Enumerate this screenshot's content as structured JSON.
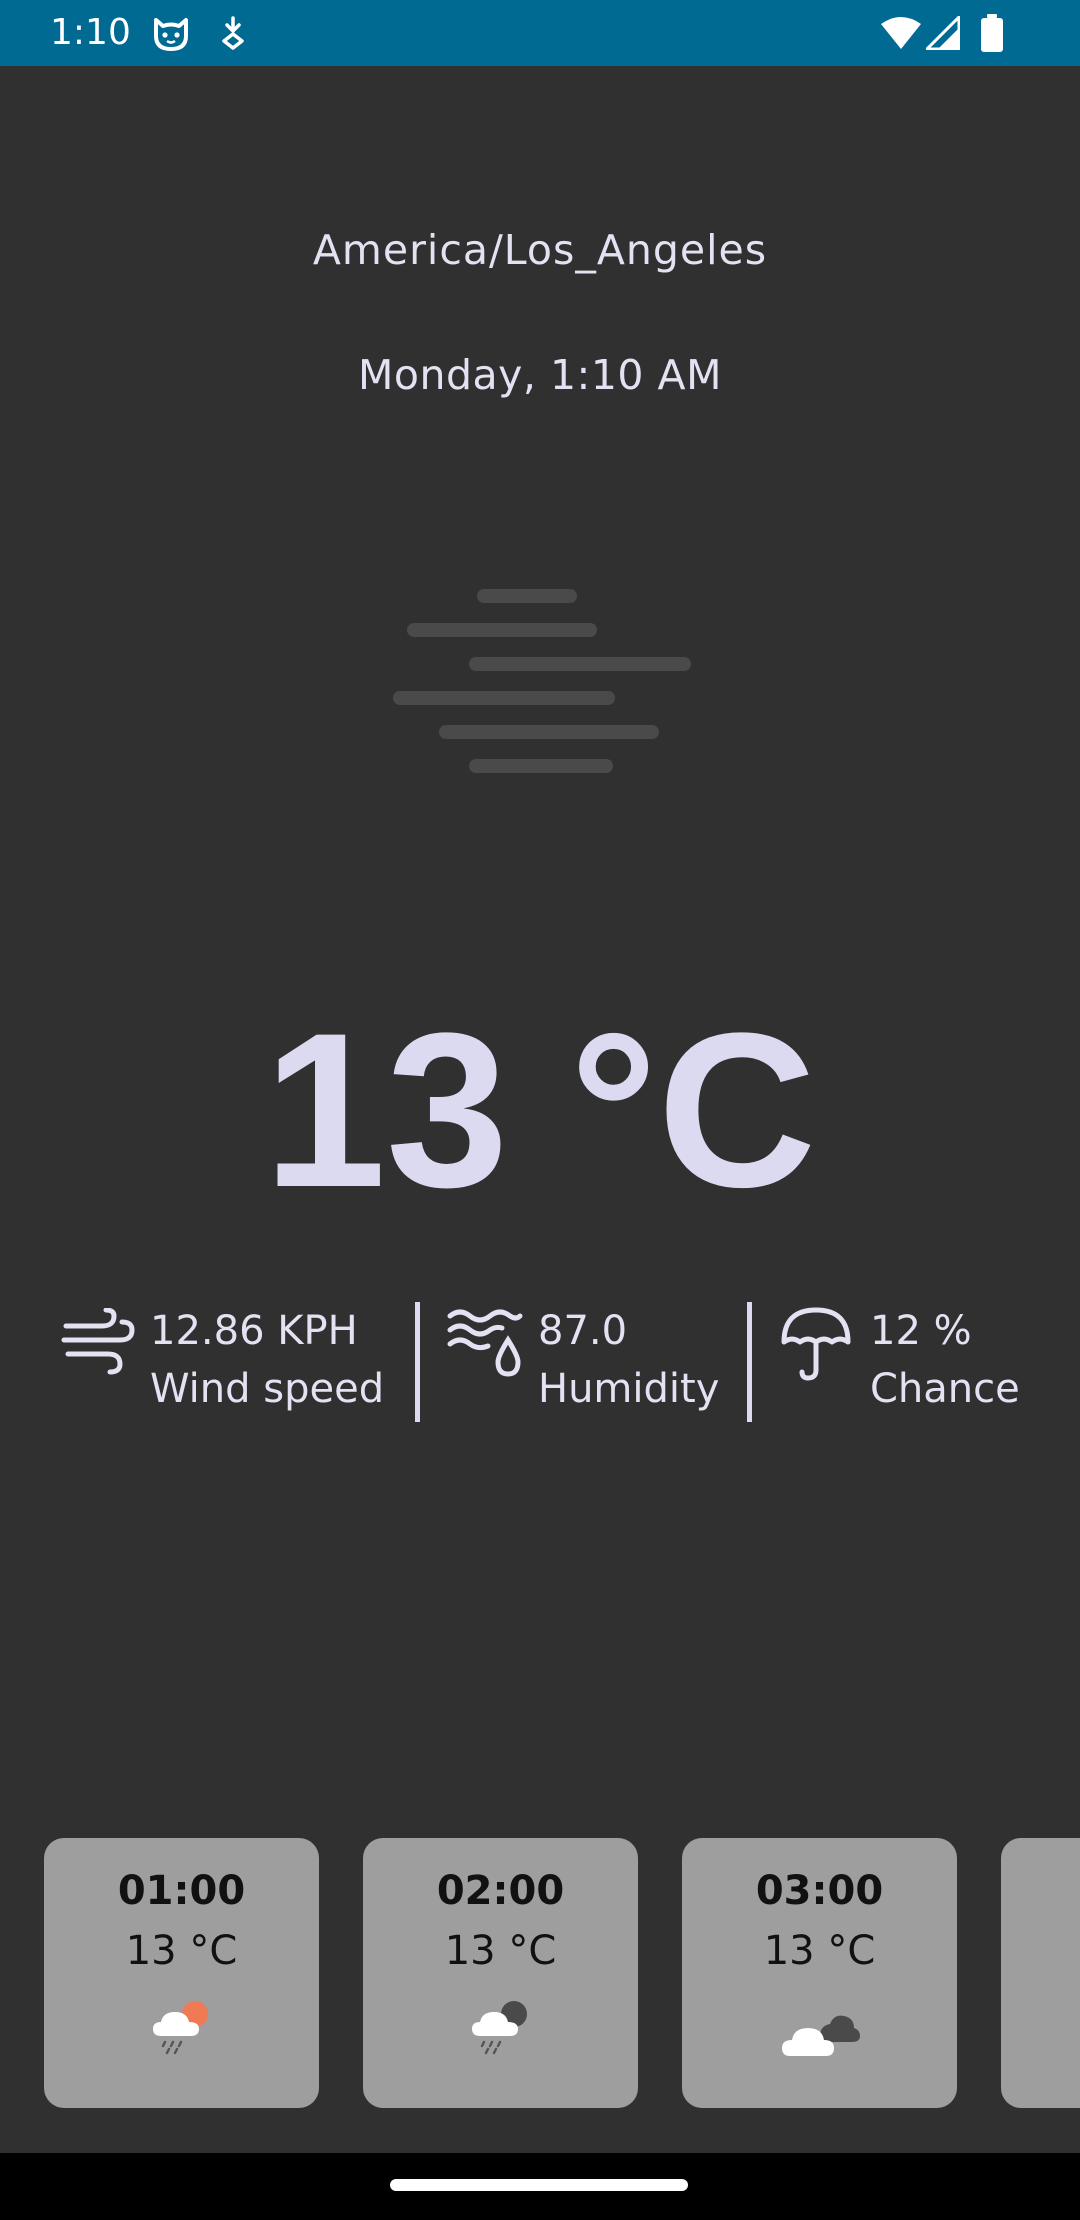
{
  "status_bar": {
    "time": "1:10",
    "icons": [
      "cat-notification-icon",
      "download-notification-icon",
      "wifi-icon",
      "cellular-signal-icon",
      "battery-icon"
    ],
    "background_color": "#006a92"
  },
  "weather": {
    "location": "America/Los_Angeles",
    "datetime": "Monday, 1:10 AM",
    "condition_icon": "fog-icon",
    "temperature": "13 °C",
    "stats": [
      {
        "icon": "wind-icon",
        "value": "12.86 KPH",
        "label": "Wind speed"
      },
      {
        "icon": "humidity-icon",
        "value": "87.0",
        "label": "Humidity"
      },
      {
        "icon": "umbrella-icon",
        "value": "12 %",
        "label": "Chance"
      }
    ]
  },
  "hourly": [
    {
      "time": "01:00",
      "temp": "13 °C",
      "icon": "rain-cloud-sun-icon"
    },
    {
      "time": "02:00",
      "temp": "13 °C",
      "icon": "rain-cloud-moon-icon"
    },
    {
      "time": "03:00",
      "temp": "13 °C",
      "icon": "cloudy-night-icon"
    }
  ],
  "colors": {
    "background": "#303030",
    "text": "#e4e1f2",
    "card": "#9e9e9e",
    "sun": "#f07a54"
  }
}
